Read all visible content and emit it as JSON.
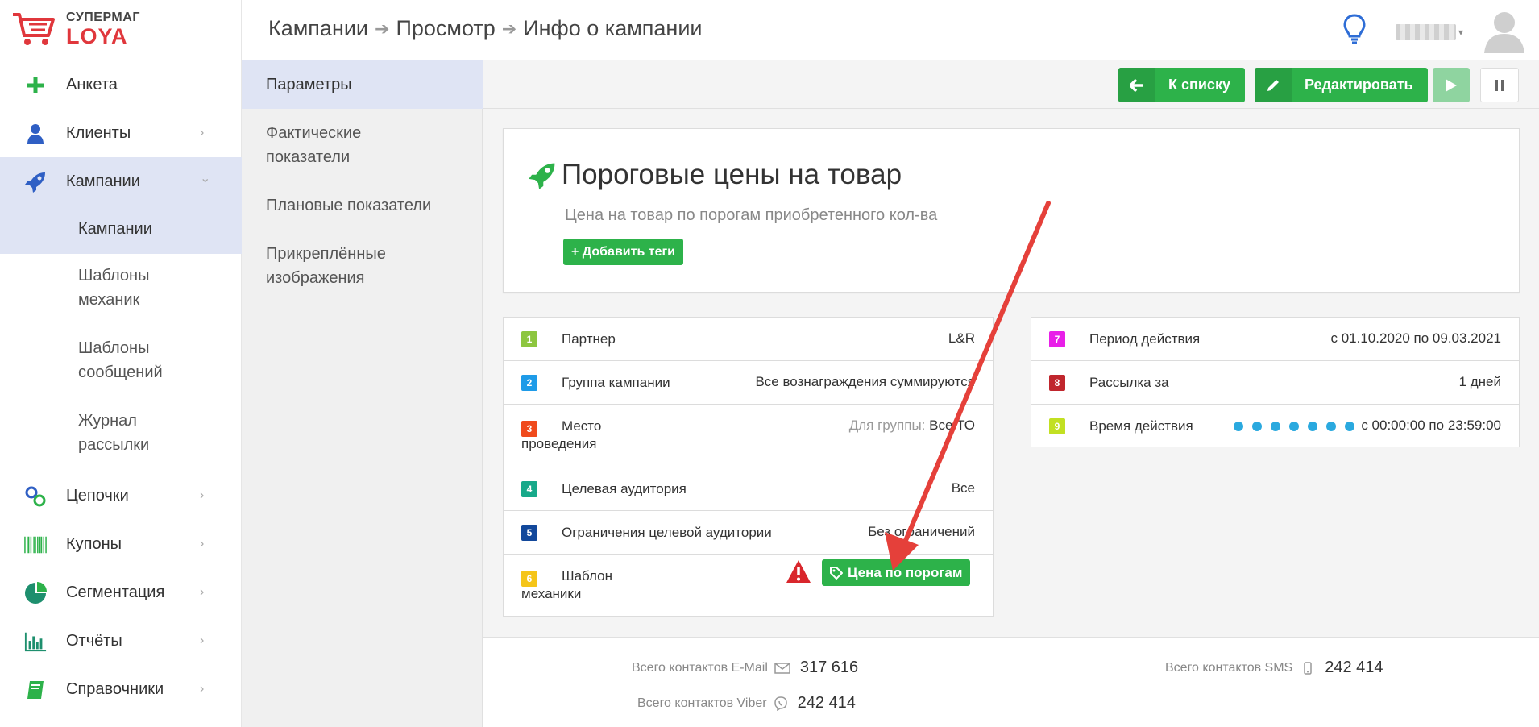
{
  "brand": {
    "line1": "СУПЕРМАГ",
    "line2": "LOYA",
    "red": "#e0373c"
  },
  "breadcrumb": [
    "Кампании",
    "Просмотр",
    "Инфо о кампании"
  ],
  "breadcrumb_sep": "➔",
  "header_icons": {
    "help": "lightbulb-icon",
    "avatar": "user-avatar-icon",
    "caret": "▾"
  },
  "sidebar": {
    "items": [
      {
        "label": "Анкета",
        "icon": "plus-icon"
      },
      {
        "label": "Клиенты",
        "icon": "user-icon"
      },
      {
        "label": "Кампании",
        "icon": "rocket-icon"
      },
      {
        "label": "Цепочки",
        "icon": "chain-icon"
      },
      {
        "label": "Купоны",
        "icon": "barcode-icon"
      },
      {
        "label": "Сегментация",
        "icon": "pie-icon"
      },
      {
        "label": "Отчёты",
        "icon": "bar-chart-icon"
      },
      {
        "label": "Справочники",
        "icon": "book-icon"
      }
    ],
    "subitems": [
      "Кампании",
      "Шаблоны механик",
      "Шаблоны сообщений",
      "Журнал рассылки"
    ],
    "chevron_right": "›",
    "chevron_down": "⌄"
  },
  "subnav": [
    "Параметры",
    "Фактические показатели",
    "Плановые показатели",
    "Прикреплённые изображения"
  ],
  "toolbar": {
    "back_label": "К списку",
    "edit_label": "Редактировать"
  },
  "campaign": {
    "title": "Пороговые цены на товар",
    "subtitle": "Цена на товар по порогам приобретенного кол-ва",
    "add_tags": "+ Добавить теги"
  },
  "params_left": [
    {
      "n": "1",
      "color": "#8dc63f",
      "label": "Партнер",
      "value": "L&R"
    },
    {
      "n": "2",
      "color": "#1e9be8",
      "label": "Группа кампании",
      "value": "Все вознаграждения суммируются"
    },
    {
      "n": "3",
      "color": "#f04a1c",
      "label": "Место проведения",
      "value_prefix": "Для группы:",
      "value": "Все ТО"
    },
    {
      "n": "4",
      "color": "#17a98a",
      "label": "Целевая аудитория",
      "value": "Все"
    },
    {
      "n": "5",
      "color": "#12489b",
      "label": "Ограничения целевой аудитории",
      "value": "Без ограничений"
    },
    {
      "n": "6",
      "color": "#f5c518",
      "label": "Шаблон механики",
      "value": "Цена по порогам"
    }
  ],
  "params_right": [
    {
      "n": "7",
      "color": "#e81fe8",
      "label": "Период действия",
      "value": "с 01.10.2020 по 09.03.2021"
    },
    {
      "n": "8",
      "color": "#c0262d",
      "label": "Рассылка за",
      "value": "1 дней"
    },
    {
      "n": "9",
      "color": "#c2e022",
      "label": "Время действия",
      "value": "с 00:00:00 по 23:59:00",
      "dot_count": 7
    }
  ],
  "contacts": [
    {
      "label": "Всего контактов E-Mail",
      "value": "317 616",
      "icon": "envelope-icon"
    },
    {
      "label": "Всего контактов SMS",
      "value": "242 414",
      "icon": "phone-icon"
    },
    {
      "label": "Всего контактов Viber",
      "value": "242 414",
      "icon": "viber-icon"
    }
  ],
  "colors": {
    "accent_green": "#2db24a",
    "active_bg": "#dfe4f4",
    "warning_red": "#d9262c",
    "annotation_arrow": "#e5403a"
  }
}
